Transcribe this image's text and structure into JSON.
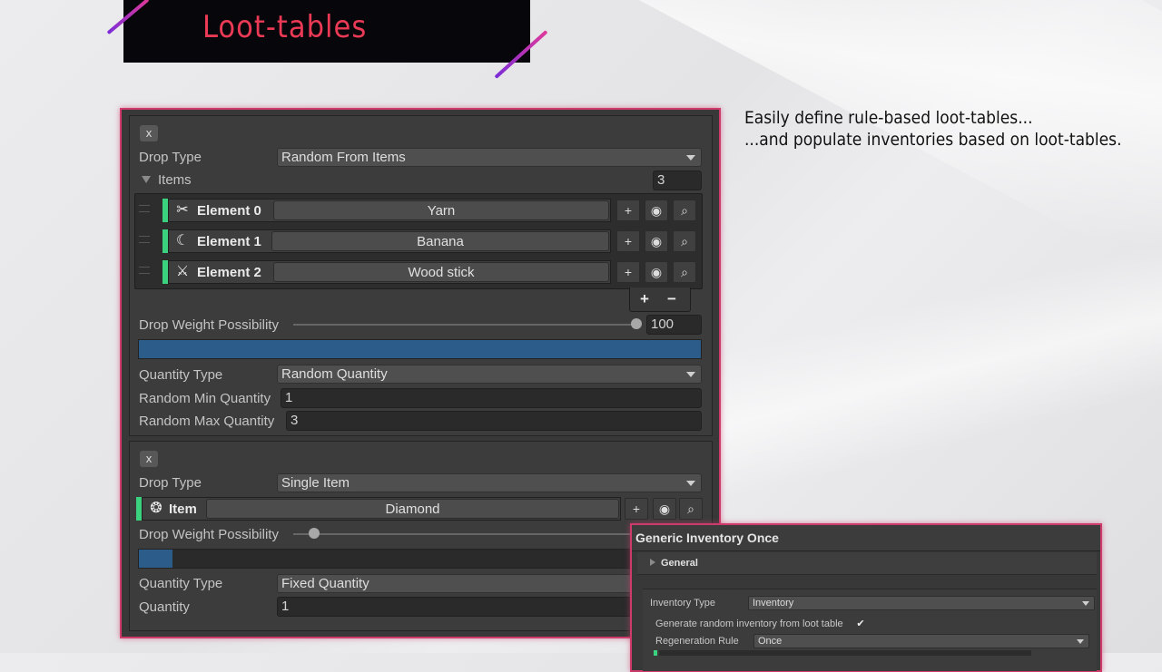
{
  "header": {
    "title": "Loot-tables"
  },
  "caption": {
    "line1": "Easily define rule-based loot-tables...",
    "line2": "...and populate inventories based on loot-tables."
  },
  "entry1": {
    "remove_label": "x",
    "drop_type_label": "Drop Type",
    "drop_type_value": "Random From Items",
    "items_label": "Items",
    "items_count": "3",
    "elements": [
      {
        "label": "Element 0",
        "value": "Yarn",
        "icon": "yarn-icon"
      },
      {
        "label": "Element 1",
        "value": "Banana",
        "icon": "banana-icon"
      },
      {
        "label": "Element 2",
        "value": "Wood stick",
        "icon": "stick-icon"
      }
    ],
    "add_label": "+",
    "remove_item_label": "−",
    "weight_label": "Drop Weight Possibility",
    "weight_value": "100",
    "weight_fraction": 1.0,
    "quantity_type_label": "Quantity Type",
    "quantity_type_value": "Random Quantity",
    "min_label": "Random Min Quantity",
    "min_value": "1",
    "max_label": "Random Max Quantity",
    "max_value": "3"
  },
  "entry2": {
    "remove_label": "x",
    "drop_type_label": "Drop Type",
    "drop_type_value": "Single Item",
    "item_label": "Item",
    "item_value": "Diamond",
    "item_icon": "diamond-icon",
    "weight_label": "Drop Weight Possibility",
    "weight_fraction": 0.06,
    "quantity_type_label": "Quantity Type",
    "quantity_type_value": "Fixed Quantity",
    "quantity_label": "Quantity",
    "quantity_value": "1"
  },
  "inventory": {
    "title": "Generic Inventory Once",
    "general_label": "General",
    "type_label": "Inventory Type",
    "type_value": "Inventory",
    "generate_label": "Generate random inventory from loot table",
    "regen_label": "Regeneration Rule",
    "regen_value": "Once"
  },
  "colors": {
    "accent": "#ea3a55",
    "frame": "#ce3a6a",
    "green": "#3ad27f",
    "progress": "#2c5c8a"
  }
}
